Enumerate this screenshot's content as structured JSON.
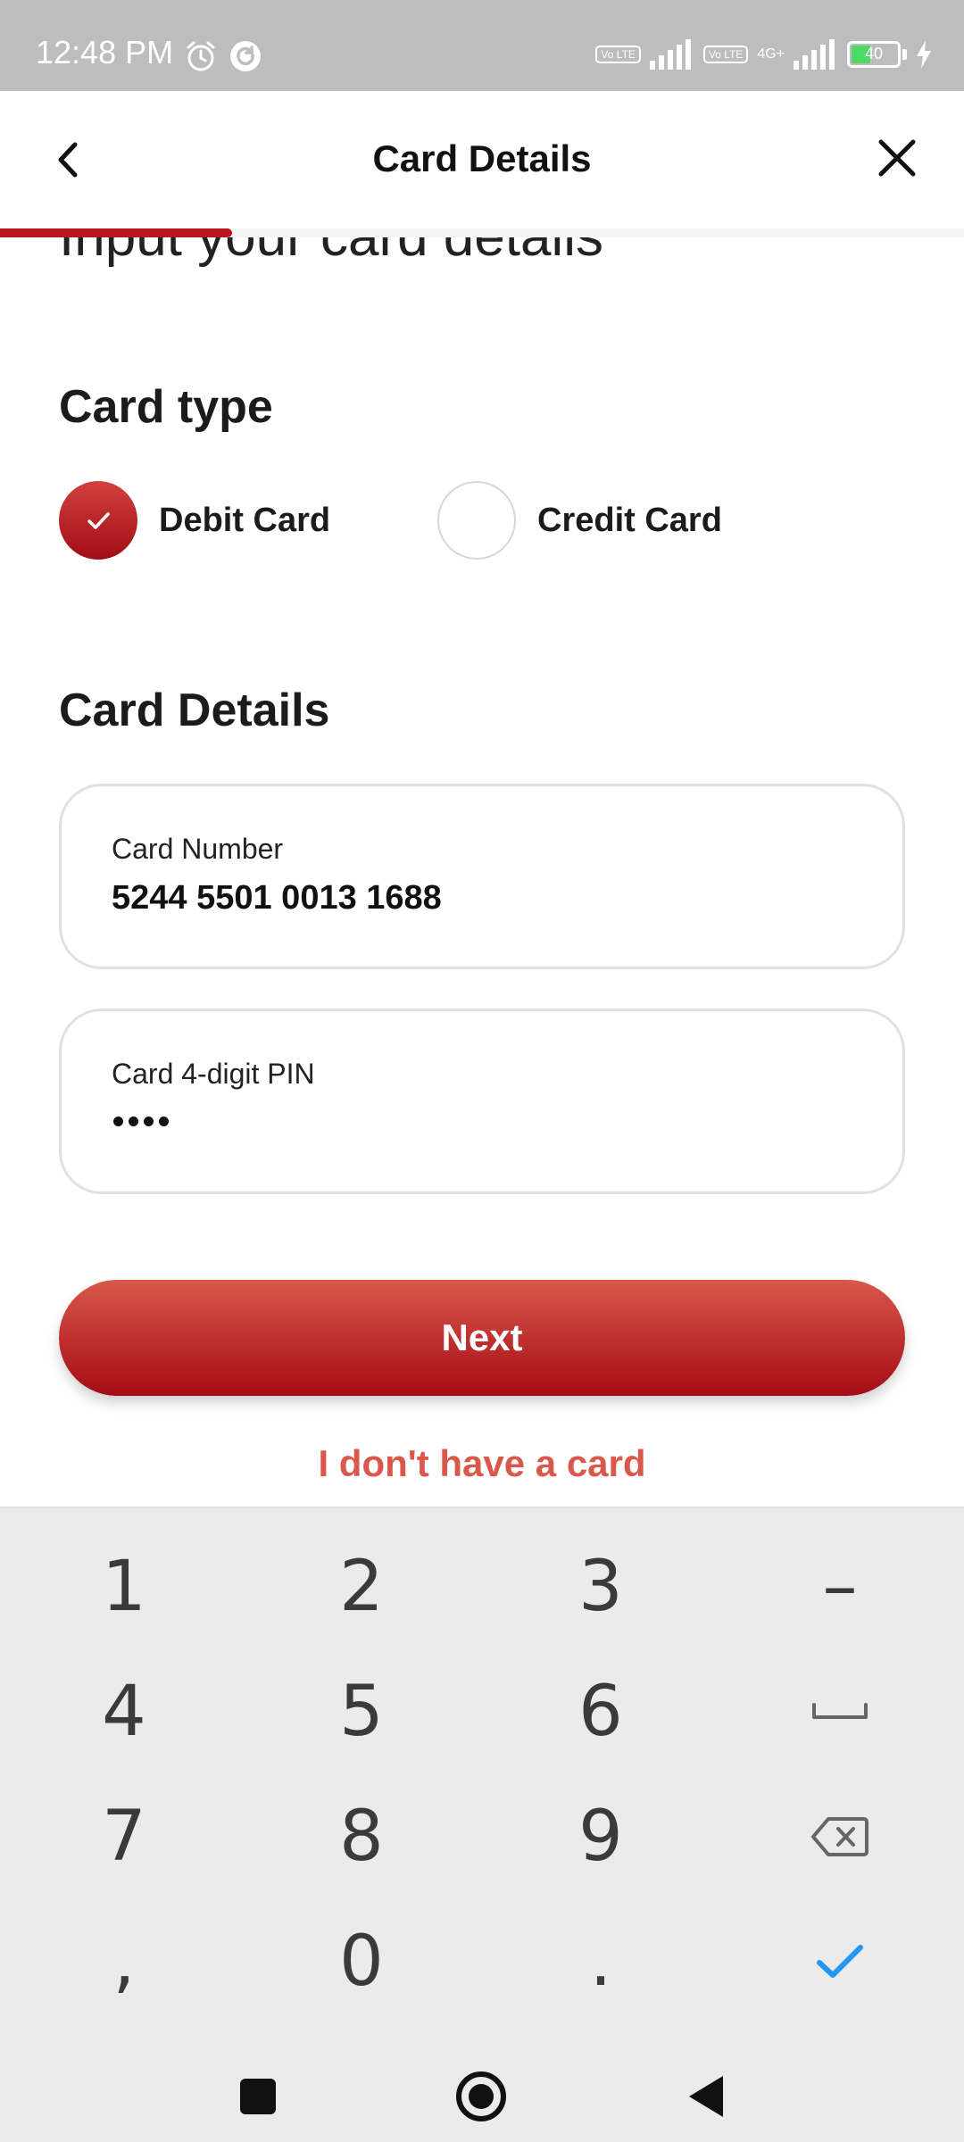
{
  "status_bar": {
    "time": "12:48 PM",
    "volte_1": "Vo LTE",
    "volte_2": "Vo LTE",
    "network": "4G+",
    "battery": "40",
    "battery_level": 0.4
  },
  "header": {
    "title": "Card Details",
    "progress": 0.25
  },
  "content": {
    "partial_heading": "Input your card details",
    "card_type_title": "Card type",
    "card_type_options": [
      {
        "label": "Debit Card",
        "selected": true
      },
      {
        "label": "Credit Card",
        "selected": false
      }
    ],
    "card_details_title": "Card Details",
    "card_number": {
      "label": "Card Number",
      "value": "5244 5501 0013 1688"
    },
    "card_pin": {
      "label": "Card 4-digit PIN",
      "masked_length": 4
    },
    "next_label": "Next",
    "no_card_label": "I don't have a card"
  },
  "keyboard": {
    "keys": [
      "1",
      "2",
      "3",
      "–",
      "4",
      "5",
      "6",
      "space",
      "7",
      "8",
      "9",
      "backspace",
      ",",
      "0",
      ".",
      "done"
    ]
  },
  "colors": {
    "accent": "#b8161f",
    "link": "#d9584b",
    "keyboard_check": "#2196f3"
  },
  "icons": {
    "back": "chevron-left-icon",
    "close": "close-icon",
    "alarm": "alarm-icon",
    "sync": "sync-icon"
  }
}
